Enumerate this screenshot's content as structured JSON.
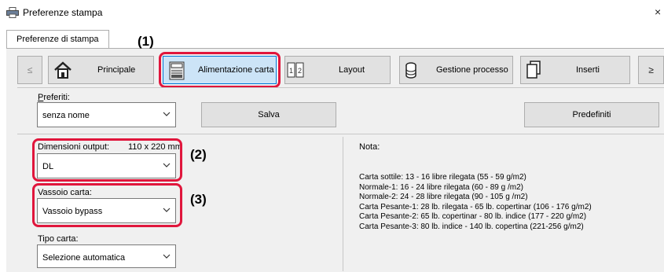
{
  "window": {
    "title": "Preferenze stampa",
    "close_glyph": "×"
  },
  "tabs": [
    {
      "label": "Preferenze di stampa"
    }
  ],
  "nav": {
    "prev_glyph": "≤",
    "next_glyph": "≥",
    "items": [
      {
        "label": "Principale",
        "icon": "home-icon"
      },
      {
        "label": "Alimentazione carta",
        "icon": "paper-feed-icon",
        "selected": true
      },
      {
        "label": "Layout",
        "icon": "layout-icon"
      },
      {
        "label": "Gestione processo",
        "icon": "job-handling-icon"
      },
      {
        "label": "Inserti",
        "icon": "inserts-icon"
      }
    ]
  },
  "callouts": {
    "c1": "(1)",
    "c2": "(2)",
    "c3": "(3)"
  },
  "favorites": {
    "label": "Preferiti:",
    "value": "senza nome",
    "save_label": "Salva",
    "defaults_label": "Predefiniti"
  },
  "output_size": {
    "label": "Dimensioni output:",
    "dims": "110 x 220 mm",
    "value": "DL"
  },
  "paper_tray": {
    "label": "Vassoio carta:",
    "value": "Vassoio bypass"
  },
  "paper_type": {
    "label": "Tipo carta:",
    "value": "Selezione automatica"
  },
  "note": {
    "title": "Nota:",
    "lines": [
      "Carta sottile: 13 - 16 libre rilegata (55 - 59 g/m2)",
      "Normale-1: 16 - 24 libre rilegata (60 - 89 g /m2)",
      "Normale-2: 24 - 28 libre rilegata (90 - 105 g /m2)",
      "Carta Pesante-1: 28 lb. rilegata - 65 lb. copertinar (106 - 176 g/m2)",
      "Carta Pesante-2: 65 lb. copertinar - 80 lb. indice (177 - 220 g/m2)",
      "Carta Pesante-3: 80 lb. indice - 140 lb. copertina (221-256 g/m2)"
    ]
  },
  "colors": {
    "highlight": "#e0163c",
    "selected_bg": "#cce4f7",
    "selected_border": "#0078d7"
  }
}
